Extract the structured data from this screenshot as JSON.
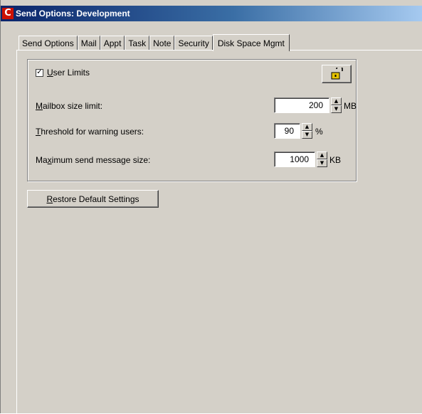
{
  "window": {
    "title": "Send Options: Development",
    "icon": "app-c-icon"
  },
  "tabs": [
    {
      "label": "Send Options",
      "active": false
    },
    {
      "label": "Mail",
      "active": false
    },
    {
      "label": "Appt",
      "active": false
    },
    {
      "label": "Task",
      "active": false
    },
    {
      "label": "Note",
      "active": false
    },
    {
      "label": "Security",
      "active": false
    },
    {
      "label": "Disk Space Mgmt",
      "active": true
    }
  ],
  "user_limits": {
    "accel": "U",
    "rest": "ser Limits",
    "checked": true,
    "check_glyph": "✓",
    "lock_icon": "unlock-icon"
  },
  "mailbox": {
    "accel": "M",
    "rest": "ailbox size limit:",
    "value": "200",
    "unit": "MB"
  },
  "threshold": {
    "accel": "T",
    "rest": "hreshold for warning users:",
    "value": "90",
    "unit": "%"
  },
  "max_send": {
    "pre": "Ma",
    "accel": "x",
    "rest": "imum send message size:",
    "value": "1000",
    "unit": "KB"
  },
  "restore": {
    "accel": "R",
    "rest": "estore Default Settings"
  },
  "spin_glyphs": {
    "up": "▲",
    "down": "▼"
  }
}
